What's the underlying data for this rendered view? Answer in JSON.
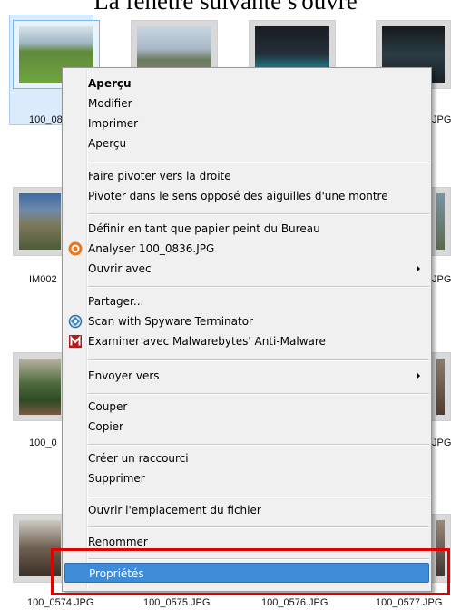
{
  "heading": "La fenêtre suivante s'ouvre",
  "thumbnails": {
    "captions": {
      "row1_left": "100_08",
      "row1_right": "JPG",
      "row2_left": "IM002",
      "row2_right": "JPG",
      "row3_left": "100_0",
      "row3_right": "JPG",
      "bottom": [
        "100_0574.JPG",
        "100_0575.JPG",
        "100_0576.JPG",
        "100_0577.JPG"
      ]
    }
  },
  "menu": {
    "items": [
      {
        "label": "Aperçu",
        "bold": true
      },
      {
        "label": "Modifier"
      },
      {
        "label": "Imprimer"
      },
      {
        "label": "Aperçu"
      },
      {
        "label": "Faire pivoter vers la droite"
      },
      {
        "label": "Pivoter dans le sens opposé des aiguilles d'une montre"
      },
      {
        "label": "Définir en tant que papier peint du Bureau"
      },
      {
        "label": "Analyser 100_0836.JPG",
        "icon": "avast-icon"
      },
      {
        "label": "Ouvrir avec",
        "submenu": true
      },
      {
        "label": "Partager..."
      },
      {
        "label": "Scan with Spyware Terminator",
        "icon": "spyware-terminator-icon"
      },
      {
        "label": "Examiner avec Malwarebytes' Anti-Malware",
        "icon": "malwarebytes-icon"
      },
      {
        "label": "Envoyer vers",
        "submenu": true
      },
      {
        "label": "Couper"
      },
      {
        "label": "Copier"
      },
      {
        "label": "Créer un raccourci"
      },
      {
        "label": "Supprimer"
      },
      {
        "label": "Ouvrir l'emplacement du fichier"
      },
      {
        "label": "Renommer"
      },
      {
        "label": "Propriétés",
        "highlighted": true
      }
    ]
  },
  "colors": {
    "highlight": "#3f8bd8",
    "annotation_box": "#e00000"
  }
}
